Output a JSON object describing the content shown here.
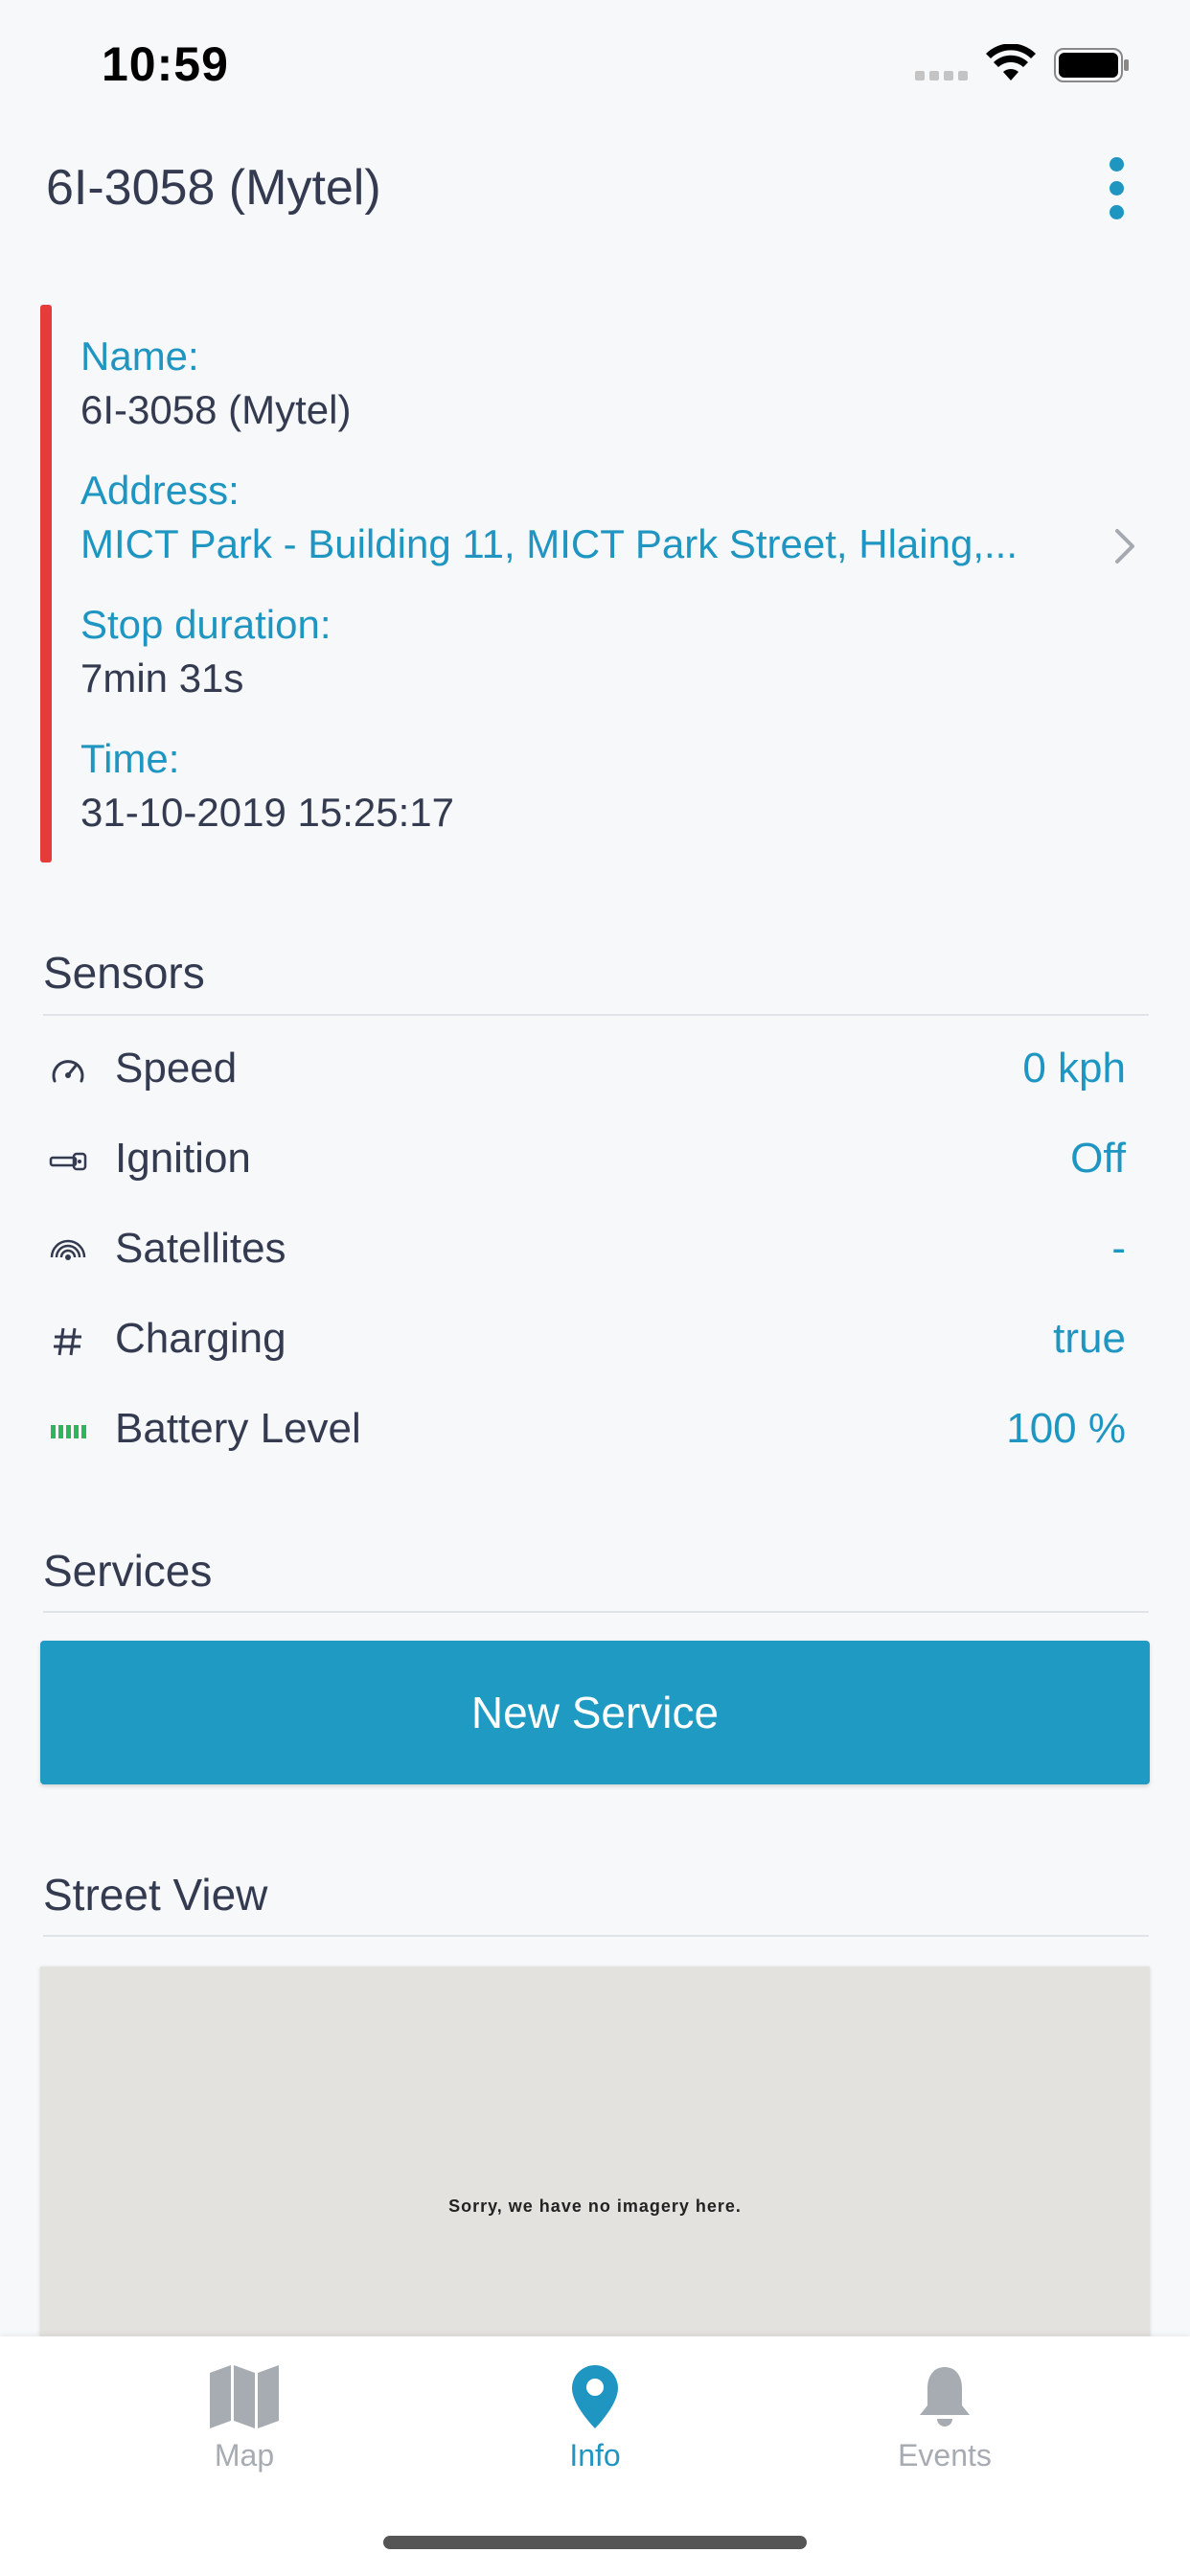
{
  "status_bar": {
    "time": "10:59"
  },
  "header": {
    "title": "6I-3058 (Mytel)"
  },
  "info": {
    "name_label": "Name:",
    "name_value": "6I-3058 (Mytel)",
    "address_label": "Address:",
    "address_value": "MICT Park - Building 11, MICT Park Street, Hlaing,...",
    "stop_label": "Stop duration:",
    "stop_value": "7min 31s",
    "time_label": "Time:",
    "time_value": "31-10-2019 15:25:17",
    "status_color": "#e53b3b"
  },
  "sensors": {
    "title": "Sensors",
    "items": [
      {
        "icon": "speedometer-icon",
        "label": "Speed",
        "value": "0 kph"
      },
      {
        "icon": "key-icon",
        "label": "Ignition",
        "value": "Off"
      },
      {
        "icon": "satellite-icon",
        "label": "Satellites",
        "value": "-"
      },
      {
        "icon": "hash-icon",
        "label": "Charging",
        "value": "true"
      },
      {
        "icon": "battery-level-icon",
        "label": "Battery Level",
        "value": "100 %"
      }
    ]
  },
  "services": {
    "title": "Services",
    "button_label": "New Service"
  },
  "street_view": {
    "title": "Street View",
    "message": "Sorry, we have no imagery here."
  },
  "tabs": [
    {
      "icon": "map-icon",
      "label": "Map",
      "active": false
    },
    {
      "icon": "location-pin-icon",
      "label": "Info",
      "active": true
    },
    {
      "icon": "bell-icon",
      "label": "Events",
      "active": false
    }
  ],
  "colors": {
    "accent": "#1f96c2",
    "button": "#1e9ac3",
    "battery_green": "#2fb65a"
  }
}
